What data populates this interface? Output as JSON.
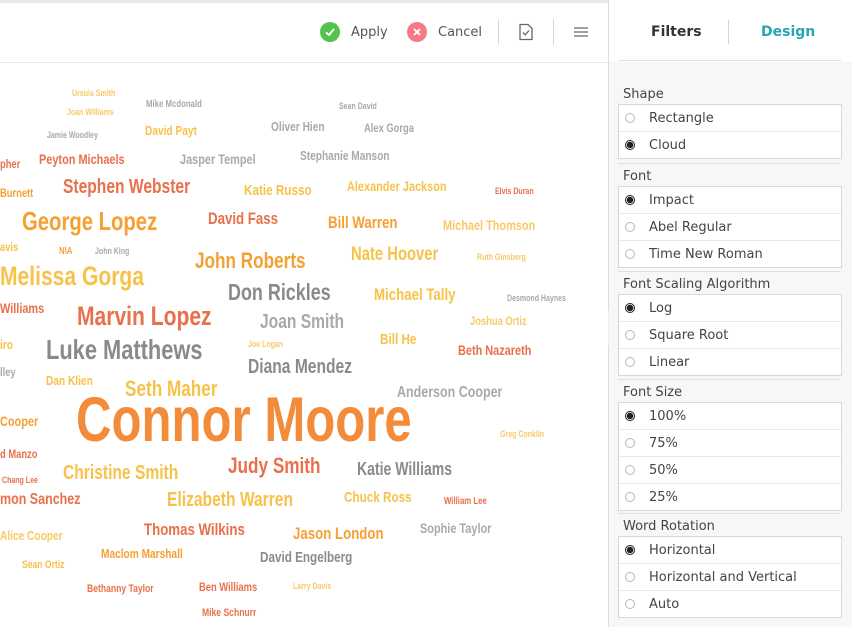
{
  "toolbar": {
    "apply_label": "Apply",
    "cancel_label": "Cancel"
  },
  "tabs": {
    "filters": "Filters",
    "design": "Design"
  },
  "sections": [
    {
      "title": "Shape",
      "options": [
        {
          "label": "Rectangle",
          "selected": false
        },
        {
          "label": "Cloud",
          "selected": true
        }
      ]
    },
    {
      "title": "Font",
      "options": [
        {
          "label": "Impact",
          "selected": true
        },
        {
          "label": "Abel Regular",
          "selected": false
        },
        {
          "label": "Time New Roman",
          "selected": false
        }
      ]
    },
    {
      "title": "Font Scaling Algorithm",
      "options": [
        {
          "label": "Log",
          "selected": true
        },
        {
          "label": "Square Root",
          "selected": false
        },
        {
          "label": "Linear",
          "selected": false
        }
      ]
    },
    {
      "title": "Font Size",
      "options": [
        {
          "label": "100%",
          "selected": true
        },
        {
          "label": "75%",
          "selected": false
        },
        {
          "label": "50%",
          "selected": false
        },
        {
          "label": "25%",
          "selected": false
        }
      ]
    },
    {
      "title": "Word Rotation",
      "options": [
        {
          "label": "Horizontal",
          "selected": true
        },
        {
          "label": "Horizontal and Vertical",
          "selected": false
        },
        {
          "label": "Auto",
          "selected": false
        }
      ]
    }
  ],
  "words": [
    "Ursula Smith",
    "Joan Williams",
    "Mike Mcdonald",
    "Sean David",
    "Jamie Woodley",
    "David Payt",
    "Oliver Hien",
    "Alex Gorga",
    "pher",
    "Peyton Michaels",
    "Jasper Tempel",
    "Stephanie Manson",
    "Burnett",
    "Stephen Webster",
    "Katie Russo",
    "Alexander Jackson",
    "Elvis Duran",
    "George Lopez",
    "David Fass",
    "Bill Warren",
    "Michael Thomson",
    "avis",
    "N\\A",
    "John King",
    "John Roberts",
    "Nate Hoover",
    "Ruth Ginsberg",
    "Melissa Gorga",
    "Don Rickles",
    "Michael Tally",
    "Desmond Haynes",
    "Williams",
    "Marvin Lopez",
    "Joan Smith",
    "Joshua Ortiz",
    "iro",
    "Joe Logan",
    "Bill He",
    "Beth Nazareth",
    "Luke Matthews",
    "Diana Mendez",
    "lley",
    "Dan Klien",
    "Seth Maher",
    "Anderson Cooper",
    "Cooper",
    "Connor Moore",
    "Greg Conklin",
    "d Manzo",
    "Judy Smith",
    "Chang Lee",
    "Christine Smith",
    "Katie Williams",
    "mon Sanchez",
    "Elizabeth Warren",
    "Chuck Ross",
    "William Lee",
    "Alice Cooper",
    "Thomas Wilkins",
    "Jason London",
    "Sophie Taylor",
    "Maclom Marshall",
    "David Engelberg",
    "Sean Ortiz",
    "Bethanny Taylor",
    "Ben Williams",
    "Larry Davis",
    "Mike Schnurr"
  ]
}
